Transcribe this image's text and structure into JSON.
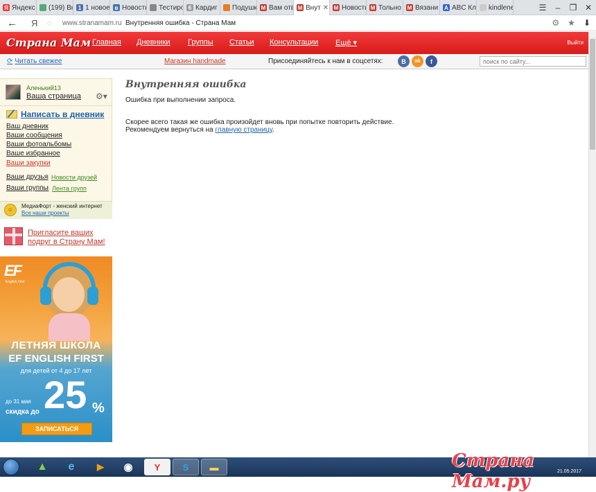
{
  "browser": {
    "tabs": [
      {
        "label": "Яндекс",
        "favicon_color": "#f33",
        "glyph": "Я"
      },
      {
        "label": "(199) Вк",
        "favicon_color": "#5a7",
        "glyph": ""
      },
      {
        "label": "1 новое",
        "favicon_color": "#4a76a8",
        "glyph": "1"
      },
      {
        "label": "Новость",
        "favicon_color": "#4a76a8",
        "glyph": "в"
      },
      {
        "label": "Тестиро",
        "favicon_color": "#888",
        "glyph": ""
      },
      {
        "label": "Кардиг",
        "favicon_color": "#999",
        "glyph": "6"
      },
      {
        "label": "Подушк",
        "favicon_color": "#e67e22",
        "glyph": ""
      },
      {
        "label": "Вам отв",
        "favicon_color": "#c0392b",
        "glyph": "M"
      },
      {
        "label": "Внут",
        "favicon_color": "#c0392b",
        "glyph": "M",
        "active": true
      },
      {
        "label": "Новости",
        "favicon_color": "#c0392b",
        "glyph": "M"
      },
      {
        "label": "Тольно",
        "favicon_color": "#c0392b",
        "glyph": "M"
      },
      {
        "label": "Вязани",
        "favicon_color": "#c0392b",
        "glyph": "M"
      },
      {
        "label": "ABC Кл",
        "favicon_color": "#36c",
        "glyph": "A"
      },
      {
        "label": "kindlene",
        "favicon_color": "#ccc",
        "glyph": ""
      }
    ],
    "url": "www.stranamam.ru",
    "page_title": "Внутренняя ошибка - Страна Мам"
  },
  "site": {
    "logo": "Страна Мам",
    "nav": [
      "Главная",
      "Дневники",
      "Группы",
      "Статьи",
      "Консультации",
      "Ещё ▾"
    ],
    "exit": "Выйти",
    "fresh_link": "Читать свежее",
    "shop_link": "Магазин handmade",
    "social_label": "Присоединяйтесь к нам в соцсетях:",
    "social": [
      {
        "glyph": "B",
        "color": "#4a6fa5"
      },
      {
        "glyph": "ok",
        "color": "#f29423"
      },
      {
        "glyph": "f",
        "color": "#3b5998"
      }
    ],
    "search_placeholder": "поиск по сайту..."
  },
  "sidebar": {
    "username": "Аленький13",
    "your_page": "Ваша страница",
    "write": "Написать в дневник",
    "links": [
      "Ваш дневник",
      "Ваши сообщения",
      "Ваши фотоальбомы",
      "Ваше избранное",
      "Ваши закупки"
    ],
    "friends": "Ваши друзья",
    "friends_news": "Новости друзей",
    "groups": "Ваши группы",
    "groups_feed": "Лента групп",
    "mf_text": "МедиаФорт - женский интернет",
    "mf_link": "Все наши проекты",
    "invite": "Пригласите ваших подруг в Страну Мам!"
  },
  "ad": {
    "brand": "EF",
    "brand_sub": "English First",
    "line1": "ЛЕТНЯЯ ШКОЛА",
    "line2": "EF ENGLISH FIRST",
    "ages": "для детей от 4 до 17 лет",
    "until": "до 31 мая",
    "discount_label": "скидка до",
    "discount": "25",
    "percent": "%",
    "cta": "ЗАПИСАТЬСЯ"
  },
  "main": {
    "title": "Внутренняя ошибка",
    "message": "Ошибка при выполнении запроса.",
    "line1": "Скорее всего такая же ошибка произойдет вновь при попытке повторить действие.",
    "line2_prefix": "Рекомендуем вернуться на ",
    "line2_link": "главную страницу",
    "line2_suffix": "."
  },
  "taskbar": {
    "watermark": "Страна Мам.ру",
    "clock": "21.05.2017"
  }
}
